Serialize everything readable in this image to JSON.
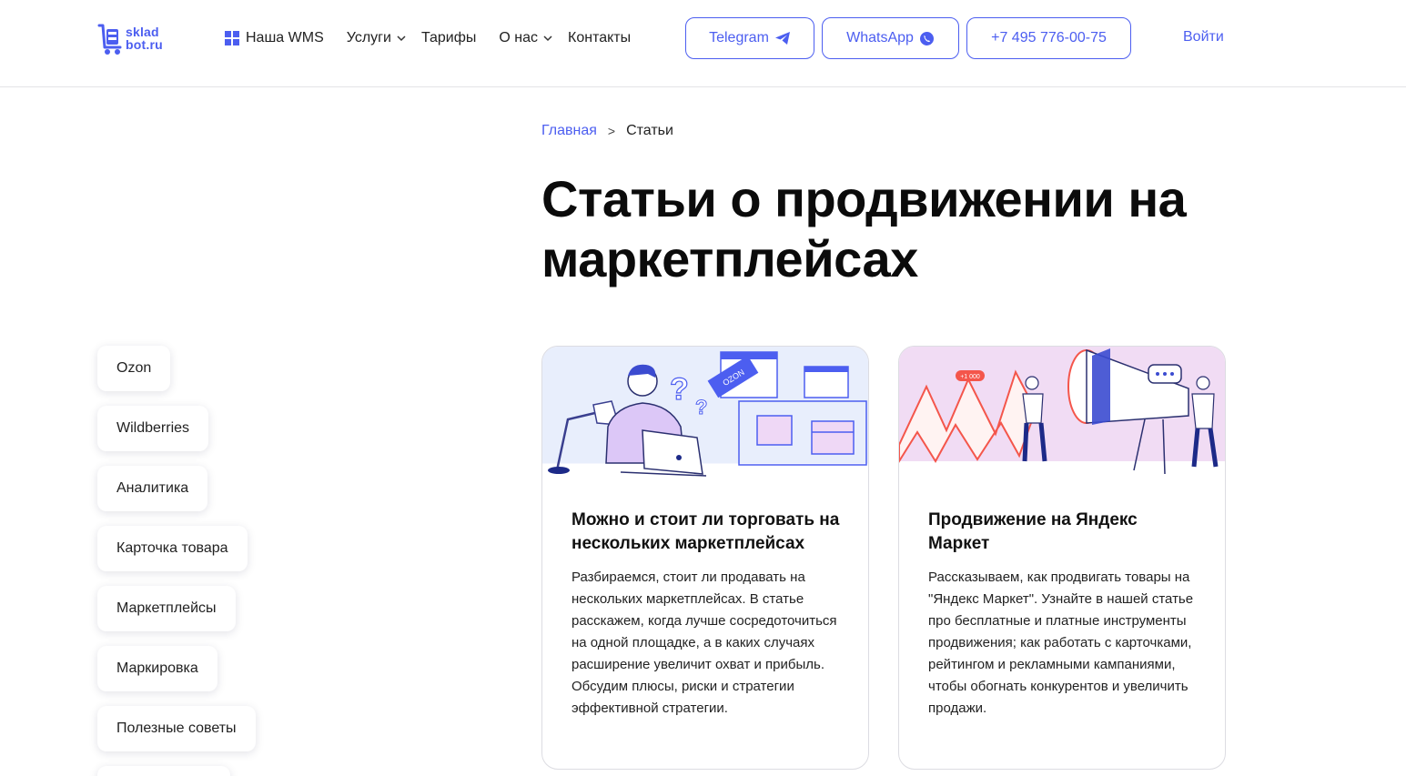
{
  "header": {
    "logo_line1": "sklad",
    "logo_line2": "bot.ru",
    "nav": [
      {
        "label": "Наша WMS"
      },
      {
        "label": "Услуги"
      },
      {
        "label": "Тарифы"
      },
      {
        "label": "О нас"
      },
      {
        "label": "Контакты"
      }
    ],
    "telegram_label": "Telegram",
    "whatsapp_label": "WhatsApp",
    "phone_label": "+7 495 776-00-75",
    "login_label": "Войти"
  },
  "breadcrumb": {
    "home": "Главная",
    "separator": ">",
    "current": "Статьи"
  },
  "page_title": "Статьи о продвижении на маркетплейсах",
  "tags": [
    "Ozon",
    "Wildberries",
    "Аналитика",
    "Карточка товара",
    "Маркетплейсы",
    "Маркировка",
    "Полезные советы"
  ],
  "cards": [
    {
      "title": "Можно и стоит ли торговать на нескольких маркетплейсах",
      "text": "Разбираемся, стоит ли продавать на нескольких маркетплейсах. В статье расскажем, когда лучше сосредоточиться на одной площадке, а в каких случаях расширение увеличит охват и прибыль. Обсудим плюсы, риски и стратегии эффективной стратегии.",
      "illustration_label": "OZON"
    },
    {
      "title": "Продвижение на Яндекс Маркет",
      "text": "Рассказываем, как продвигать товары на \"Яндекс Маркет\". Узнайте в нашей статье про бесплатные и платные инструменты продвижения; как работать с карточками, рейтингом и рекламными кампаниями, чтобы обогнать конкурентов и увеличить продажи.",
      "illustration_badge": "+1 000"
    }
  ],
  "colors": {
    "accent": "#4c5ef0",
    "card1_bg": "#e8eefc",
    "card2_bg": "#f1dcf4",
    "card2_letter": "#f4564b"
  },
  "icons": [
    "wms-grid-icon",
    "chevron-down-icon",
    "telegram-icon",
    "whatsapp-icon",
    "logo-cart-icon"
  ]
}
